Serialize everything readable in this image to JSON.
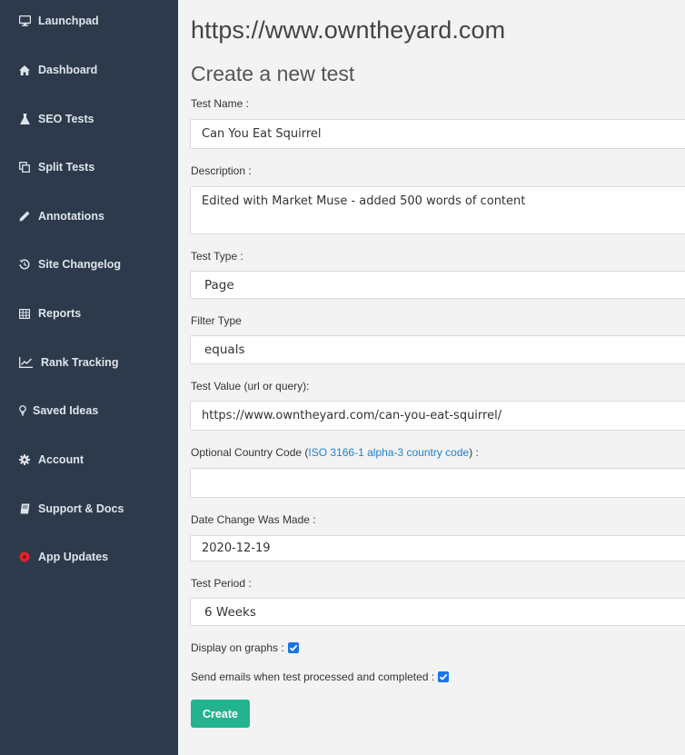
{
  "sidebar": {
    "items": [
      {
        "label": "Launchpad",
        "icon": "monitor-icon"
      },
      {
        "label": "Dashboard",
        "icon": "home-icon"
      },
      {
        "label": "SEO Tests",
        "icon": "flask-icon"
      },
      {
        "label": "Split Tests",
        "icon": "copy-icon"
      },
      {
        "label": "Annotations",
        "icon": "pencil-icon"
      },
      {
        "label": "Site Changelog",
        "icon": "history-icon"
      },
      {
        "label": "Reports",
        "icon": "table-icon"
      },
      {
        "label": "Rank Tracking",
        "icon": "line-chart-icon"
      },
      {
        "label": "Saved Ideas",
        "icon": "lightbulb-icon"
      },
      {
        "label": "Account",
        "icon": "gear-icon"
      },
      {
        "label": "Support & Docs",
        "icon": "book-icon"
      },
      {
        "label": "App Updates",
        "icon": "notification-dot-icon"
      }
    ]
  },
  "header": {
    "site_url": "https://www.owntheyard.com",
    "form_title": "Create a new test"
  },
  "form": {
    "test_name": {
      "label": "Test Name :",
      "value": "Can You Eat Squirrel"
    },
    "description": {
      "label": "Description :",
      "value": "Edited with Market Muse - added 500 words of content"
    },
    "test_type": {
      "label": "Test Type :",
      "value": "Page"
    },
    "filter_type": {
      "label": "Filter Type",
      "value": "equals"
    },
    "test_value": {
      "label": "Test Value (url or query):",
      "value": "https://www.owntheyard.com/can-you-eat-squirrel/"
    },
    "country_code": {
      "label_prefix": "Optional Country Code (",
      "link_text": "ISO 3166-1 alpha-3 country code",
      "label_suffix": ") :",
      "value": ""
    },
    "date_change": {
      "label": "Date Change Was Made :",
      "value": "2020-12-19"
    },
    "test_period": {
      "label": "Test Period :",
      "value": "6 Weeks"
    },
    "display_on_graphs": {
      "label": "Display on graphs :",
      "checked": true
    },
    "send_emails": {
      "label": "Send emails when test processed and completed :",
      "checked": true
    },
    "create_label": "Create"
  },
  "colors": {
    "sidebar_bg": "#2c3a4b",
    "accent": "#24b38f",
    "link": "#1d7fd1",
    "checkbox": "#1a73e8",
    "notification_dot": "#e0252a"
  }
}
